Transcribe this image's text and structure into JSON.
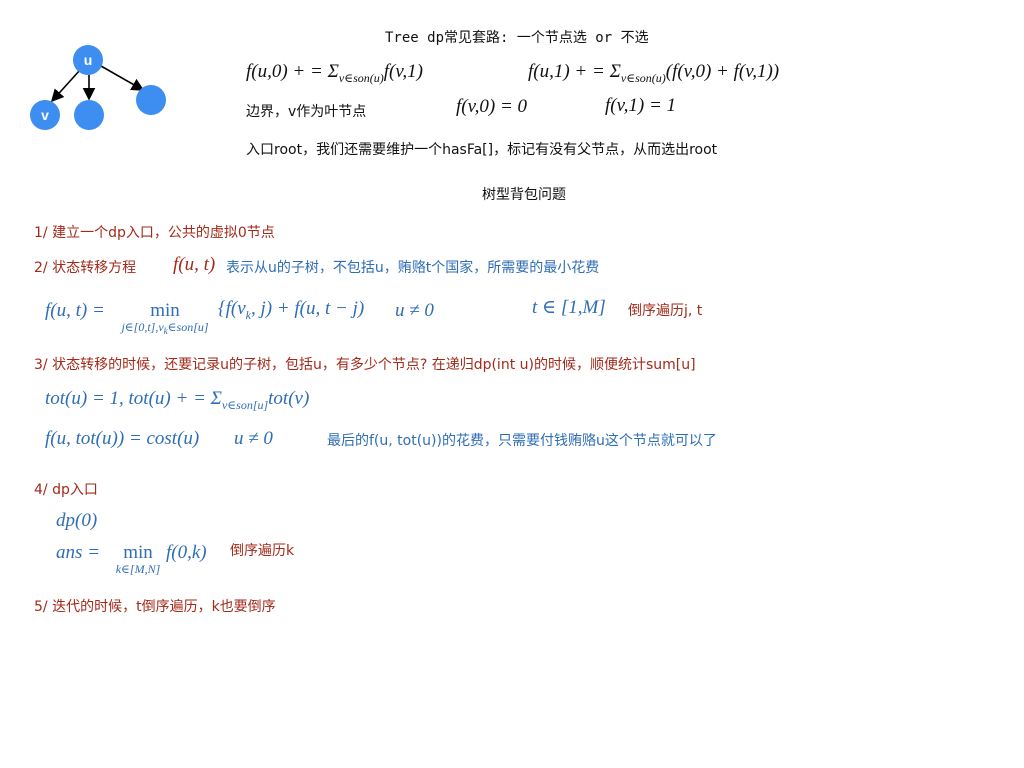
{
  "title": "Tree dp常见套路: 一个节点选 or 不选",
  "tree": {
    "root_label": "u",
    "child_label": "v",
    "node_color": "#3d8ef0"
  },
  "header": {
    "eq_f0": "f(u,0) + = Σ",
    "eq_f0_sub": "v∈son(u)",
    "eq_f0_tail": "f(v,1)",
    "eq_f1": "f(u,1) + = Σ",
    "eq_f1_sub": "v∈son(u)",
    "eq_f1_tail": "(f(v,0) + f(v,1))",
    "boundary_label": "边界，v作为叶节点",
    "boundary_f0": "f(v,0) = 0",
    "boundary_f1": "f(v,1) = 1",
    "root_note": "入口root，我们还需要维护一个hasFa[]，标记有没有父节点，从而选出root"
  },
  "section_title": "树型背包问题",
  "steps": {
    "s1": "1/ 建立一个dp入口，公共的虚拟0节点",
    "s2_prefix": "2/ 状态转移方程",
    "s2_func": "f(u, t)",
    "s2_desc": "表示从u的子树，不包括u，贿赂t个国家，所需要的最小花费",
    "s2_eq_left": "f(u, t) = ",
    "s2_min": "min",
    "s2_min_sub": "j∈[0,t],v",
    "s2_min_sub2": "k",
    "s2_min_sub3": "∈son[u]",
    "s2_eq_body": "{f(v",
    "s2_eq_body_sub": "k",
    "s2_eq_body_tail": ", j) + f(u, t − j)",
    "s2_cond": "u ≠ 0",
    "s2_range": "t ∈ [1,M]",
    "s2_order": "倒序遍历j, t",
    "s3": "3/ 状态转移的时候，还要记录u的子树，包括u，有多少个节点? 在递归dp(int u)的时候，顺便统计sum[u]",
    "s3_tot": "tot(u) = 1, tot(u) + = Σ",
    "s3_tot_sub": "v∈son[u]",
    "s3_tot_tail": "tot(v)",
    "s3_cost": "f(u, tot(u)) = cost(u)",
    "s3_cond": "u ≠ 0",
    "s3_note": "最后的f(u, tot(u))的花费，只需要付钱贿赂u这个节点就可以了",
    "s4": "4/ dp入口",
    "s4_dp": "dp(0)",
    "s4_ans": "ans = ",
    "s4_min": "min",
    "s4_min_sub": "k∈[M,N]",
    "s4_ans_tail": "f(0,k)",
    "s4_order": "倒序遍历k",
    "s5": "5/ 迭代的时候，t倒序遍历，k也要倒序"
  },
  "colors": {
    "red": "#a32a1a",
    "blue": "#2f6db5",
    "node": "#3d8ef0"
  }
}
